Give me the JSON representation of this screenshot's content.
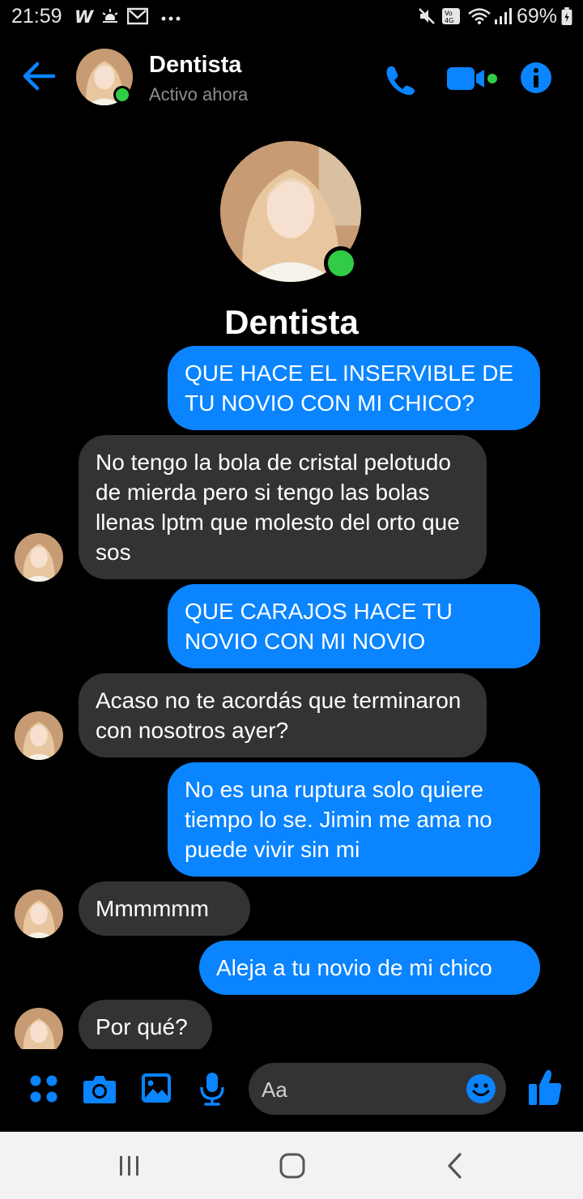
{
  "status_bar": {
    "time": "21:59",
    "battery": "69%",
    "icons": [
      "w-app-icon",
      "weather-icon",
      "gmail-icon",
      "more-dots-icon",
      "mute-icon",
      "volte-4g-icon",
      "wifi-icon",
      "signal-icon",
      "battery-icon"
    ]
  },
  "header": {
    "contact_name": "Dentista",
    "status": "Activo ahora",
    "icons": [
      "back-arrow-icon",
      "phone-icon",
      "video-icon",
      "info-icon"
    ]
  },
  "profile": {
    "name": "Dentista"
  },
  "messages": [
    {
      "dir": "out",
      "text": "QUE HACE EL INSERVIBLE DE TU NOVIO CON MI CHICO?"
    },
    {
      "dir": "in",
      "text": "No tengo la bola de cristal pelotudo de mierda pero si tengo las bolas llenas lptm que molesto del orto que sos"
    },
    {
      "dir": "out",
      "text": "QUE CARAJOS HACE TU NOVIO CON MI NOVIO"
    },
    {
      "dir": "in",
      "text": "Acaso no te acordás que terminaron con nosotros ayer?"
    },
    {
      "dir": "out",
      "text": "No es una ruptura solo quiere tiempo lo se. Jimin me ama no puede vivir sin mi"
    },
    {
      "dir": "in",
      "text": "Mmmmmm"
    },
    {
      "dir": "out",
      "text": "Aleja a tu novio de mi chico"
    },
    {
      "dir": "in",
      "text": "Por qué?"
    }
  ],
  "composer": {
    "placeholder": "Aa",
    "icons": [
      "apps-menu-icon",
      "camera-icon",
      "gallery-icon",
      "microphone-icon",
      "emoji-icon",
      "thumbs-up-icon"
    ]
  },
  "colors": {
    "accent": "#0a84ff",
    "incoming_bubble": "#333335",
    "online": "#31cc46",
    "background": "#000000"
  }
}
